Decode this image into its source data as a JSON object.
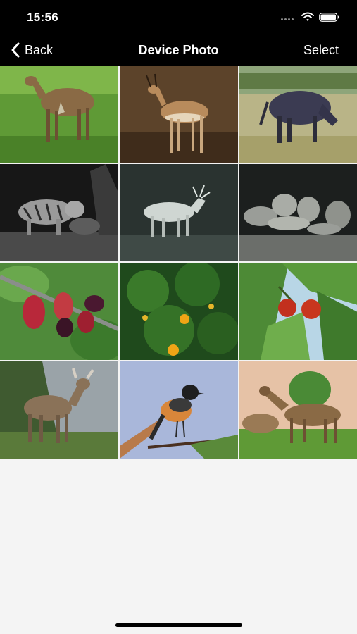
{
  "status_bar": {
    "time": "15:56",
    "icons": [
      "signal-dots-icon",
      "wifi-icon",
      "battery-icon"
    ]
  },
  "nav": {
    "back_label": "Back",
    "title": "Device Photo",
    "select_label": "Select"
  },
  "photos": [
    {
      "subject": "deer"
    },
    {
      "subject": "gazelle"
    },
    {
      "subject": "wildebeest"
    },
    {
      "subject": "tiger"
    },
    {
      "subject": "stag"
    },
    {
      "subject": "lions"
    },
    {
      "subject": "mulberries"
    },
    {
      "subject": "orange-tree"
    },
    {
      "subject": "cherries"
    },
    {
      "subject": "deer"
    },
    {
      "subject": "bird"
    },
    {
      "subject": "dik-dik"
    }
  ],
  "colors": {
    "bar_background": "#000000",
    "bar_text": "#ffffff",
    "page_background": "#f4f4f4"
  }
}
